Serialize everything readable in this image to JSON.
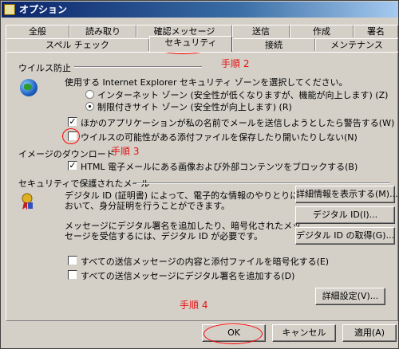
{
  "window": {
    "title": "オプション"
  },
  "tabs_row1": [
    "全般",
    "読み取り",
    "確認メッセージ",
    "送信",
    "作成",
    "署名"
  ],
  "tabs_row2": [
    "スペル チェック",
    "セキュリティ",
    "接続",
    "メンテナンス"
  ],
  "virus": {
    "section": "ウイルス防止",
    "zone_prompt": "使用する Internet Explorer セキュリティ ゾーンを選択してください。",
    "radio1": "インターネット ゾーン (安全性が低くなりますが、機能が向上します) (Z)",
    "radio2": "制限付きサイト ゾーン (安全性が向上します) (R)",
    "check1": "ほかのアプリケーションが私の名前でメールを送信しようとしたら警告する(W)",
    "check2": "ウイルスの可能性がある添付ファイルを保存したり開いたりしない(N)"
  },
  "images": {
    "section": "イメージのダウンロード",
    "check": "HTML 電子メールにある画像および外部コンテンツをブロックする(B)"
  },
  "secure_mail": {
    "section": "セキュリティで保護されたメール",
    "desc1_line1": "デジタル ID (証明書) によって、電子的な情報のやりとりに",
    "desc1_line2": "おいて、身分証明を行うことができます。",
    "desc2_line1": "メッセージにデジタル署名を追加したり、暗号化されたメッ",
    "desc2_line2": "セージを受信するには、デジタル ID が必要です。",
    "btn_details": "詳細情報を表示する(M)...",
    "btn_digital_id": "デジタル ID(I)...",
    "btn_get_id": "デジタル ID の取得(G)...",
    "check_encrypt": "すべての送信メッセージの内容と添付ファイルを暗号化する(E)",
    "check_sign": "すべての送信メッセージにデジタル署名を追加する(D)",
    "btn_advanced": "詳細設定(V)..."
  },
  "footer": {
    "ok": "OK",
    "cancel": "キャンセル",
    "apply": "適用(A)"
  },
  "annotations": {
    "step2": "手順 2",
    "step3": "手順 3",
    "step4": "手順 4"
  },
  "colors": {
    "annotation": "#e81010",
    "titlebar": "#0a246a"
  }
}
